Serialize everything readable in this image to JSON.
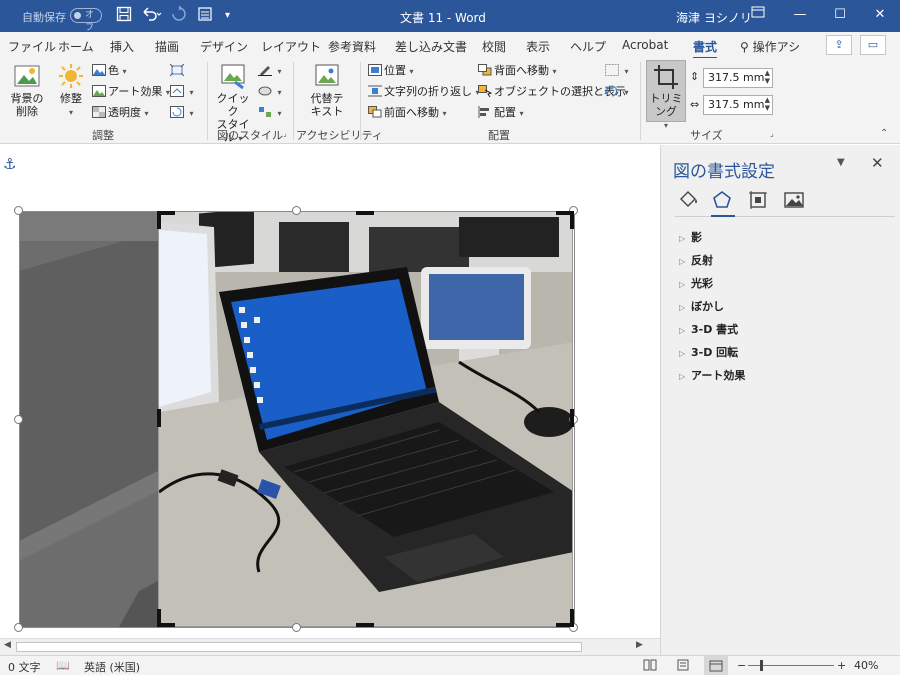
{
  "titlebar": {
    "autosave_label": "自動保存",
    "autosave_state": "オフ",
    "doc_title": "文書 11  -  Word",
    "user": "海津 ヨシノリ",
    "bg_color": "#2b579a"
  },
  "tabs": [
    {
      "label": "ファイル"
    },
    {
      "label": "ホーム"
    },
    {
      "label": "挿入"
    },
    {
      "label": "描画"
    },
    {
      "label": "デザイン"
    },
    {
      "label": "レイアウト"
    },
    {
      "label": "参考資料"
    },
    {
      "label": "差し込み文書"
    },
    {
      "label": "校閲"
    },
    {
      "label": "表示"
    },
    {
      "label": "ヘルプ"
    },
    {
      "label": "Acrobat"
    },
    {
      "label": "書式"
    }
  ],
  "search_label": "操作アシ",
  "ribbon": {
    "remove_bg": "背景の\n削除",
    "corrections": "修整",
    "color": "色",
    "artistic_effects": "アート効果",
    "transparency": "透明度",
    "group_adjust": "調整",
    "quick_styles": "クイック\nスタイル",
    "group_styles": "図のスタイル",
    "alt_text": "代替テ\nキスト",
    "group_accessibility": "アクセシビリティ",
    "position": "位置",
    "wrap_text": "文字列の折り返し",
    "bring_forward": "前面へ移動",
    "send_backward": "背面へ移動",
    "selection_pane": "オブジェクトの選択と表示",
    "align": "配置",
    "group_arrange": "配置",
    "crop": "トリミング",
    "height": "317.5 mm",
    "width": "317.5 mm",
    "group_size": "サイズ"
  },
  "pane": {
    "title": "図の書式設定",
    "icons": [
      "fill-line-icon",
      "effects-icon",
      "layout-properties-icon",
      "picture-icon"
    ],
    "items": [
      {
        "label": "影"
      },
      {
        "label": "反射"
      },
      {
        "label": "光彩"
      },
      {
        "label": "ぼかし"
      },
      {
        "label": "3-D 書式"
      },
      {
        "label": "3-D 回転"
      },
      {
        "label": "アート効果"
      }
    ]
  },
  "status": {
    "word_count": "0 文字",
    "language": "英語 (米国)",
    "zoom": "40%"
  },
  "colors": {
    "accent": "#2b579a",
    "ribbon_bg": "#f3f3f3",
    "crop_area": "#6d6d6d",
    "screen_blue": "#1a5ec8"
  }
}
